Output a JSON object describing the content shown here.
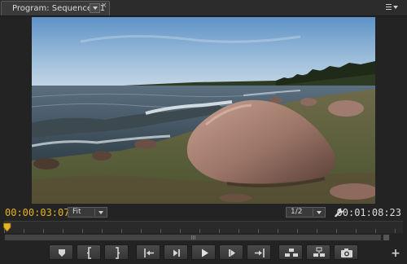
{
  "panel": {
    "tab_label": "Program: Sequence 01",
    "close_glyph": "×",
    "menu_icon": "panel-menu-icon"
  },
  "info": {
    "current_timecode": "00:00:03:07",
    "zoom_value": "Fit",
    "resolution_value": "1/2",
    "duration_timecode": "00:01:08:23",
    "settings_icon": "wrench-icon"
  },
  "colors": {
    "current_timecode": "#e6b325",
    "panel_bg": "#232323"
  },
  "transport": [
    {
      "name": "add-marker-button",
      "icon": "marker-icon"
    },
    {
      "name": "mark-in-button",
      "icon": "mark-in-icon"
    },
    {
      "name": "mark-out-button",
      "icon": "mark-out-icon"
    },
    {
      "name": "go-to-in-button",
      "icon": "go-to-in-icon"
    },
    {
      "name": "step-back-button",
      "icon": "step-back-icon"
    },
    {
      "name": "play-button",
      "icon": "play-icon"
    },
    {
      "name": "step-forward-button",
      "icon": "step-forward-icon"
    },
    {
      "name": "go-to-out-button",
      "icon": "go-to-out-icon"
    },
    {
      "name": "lift-button",
      "icon": "lift-icon"
    },
    {
      "name": "extract-button",
      "icon": "extract-icon"
    },
    {
      "name": "export-frame-button",
      "icon": "camera-icon"
    }
  ],
  "add_button_glyph": "+"
}
